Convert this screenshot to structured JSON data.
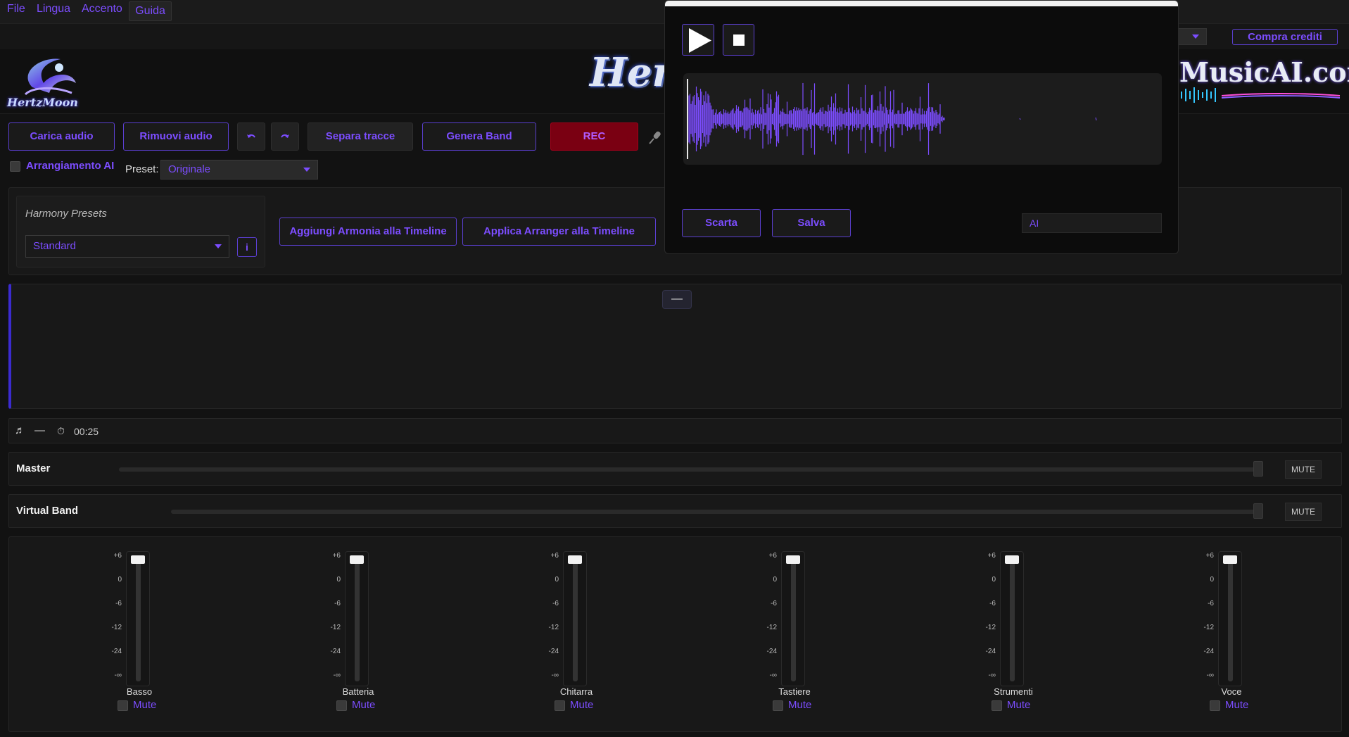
{
  "menu": {
    "items": [
      "File",
      "Lingua",
      "Accento"
    ],
    "guida": "Guida"
  },
  "header": {
    "buy_credits": "Compra crediti",
    "logo_left_text": "HertzMoon",
    "logo_center_text": "Hertz",
    "logo_right_text": "MusicAI.com"
  },
  "toolbar": {
    "load_audio": "Carica audio",
    "remove_audio": "Rimuovi audio",
    "separate_tracks": "Separa tracce",
    "generate_band": "Genera Band",
    "rec": "REC"
  },
  "arrangement": {
    "ai_label": "Arrangiamento AI",
    "preset_label": "Preset:",
    "preset_value": "Originale"
  },
  "harmony": {
    "title": "Harmony Presets",
    "selected": "Standard",
    "info": "i",
    "add_harmony": "Aggiungi Armonia alla Timeline",
    "apply_arranger": "Applica Arranger alla Timeline"
  },
  "timeline": {
    "collapse": "—"
  },
  "status": {
    "dash": "—",
    "time": "00:25"
  },
  "master": {
    "label": "Master",
    "mute": "MUTE",
    "level": 1.0
  },
  "virtual_band": {
    "label": "Virtual Band",
    "mute": "MUTE",
    "level": 1.0
  },
  "mixer": {
    "scale": [
      "+6",
      "0",
      "-6",
      "-12",
      "-24",
      "-∞"
    ],
    "mute_label": "Mute",
    "channels": [
      {
        "name": "Basso",
        "level_db": "+6"
      },
      {
        "name": "Batteria",
        "level_db": "+6"
      },
      {
        "name": "Chitarra",
        "level_db": "+6"
      },
      {
        "name": "Tastiere",
        "level_db": "+6"
      },
      {
        "name": "Strumenti",
        "level_db": "+6"
      },
      {
        "name": "Voce",
        "level_db": "+6"
      }
    ]
  },
  "recorder": {
    "discard": "Scarta",
    "save": "Salva",
    "name_value": "AI",
    "waveform_color": "#7c4dff"
  },
  "colors": {
    "accent": "#7c4dff",
    "rec_bg": "#7a0012",
    "background": "#121212"
  }
}
